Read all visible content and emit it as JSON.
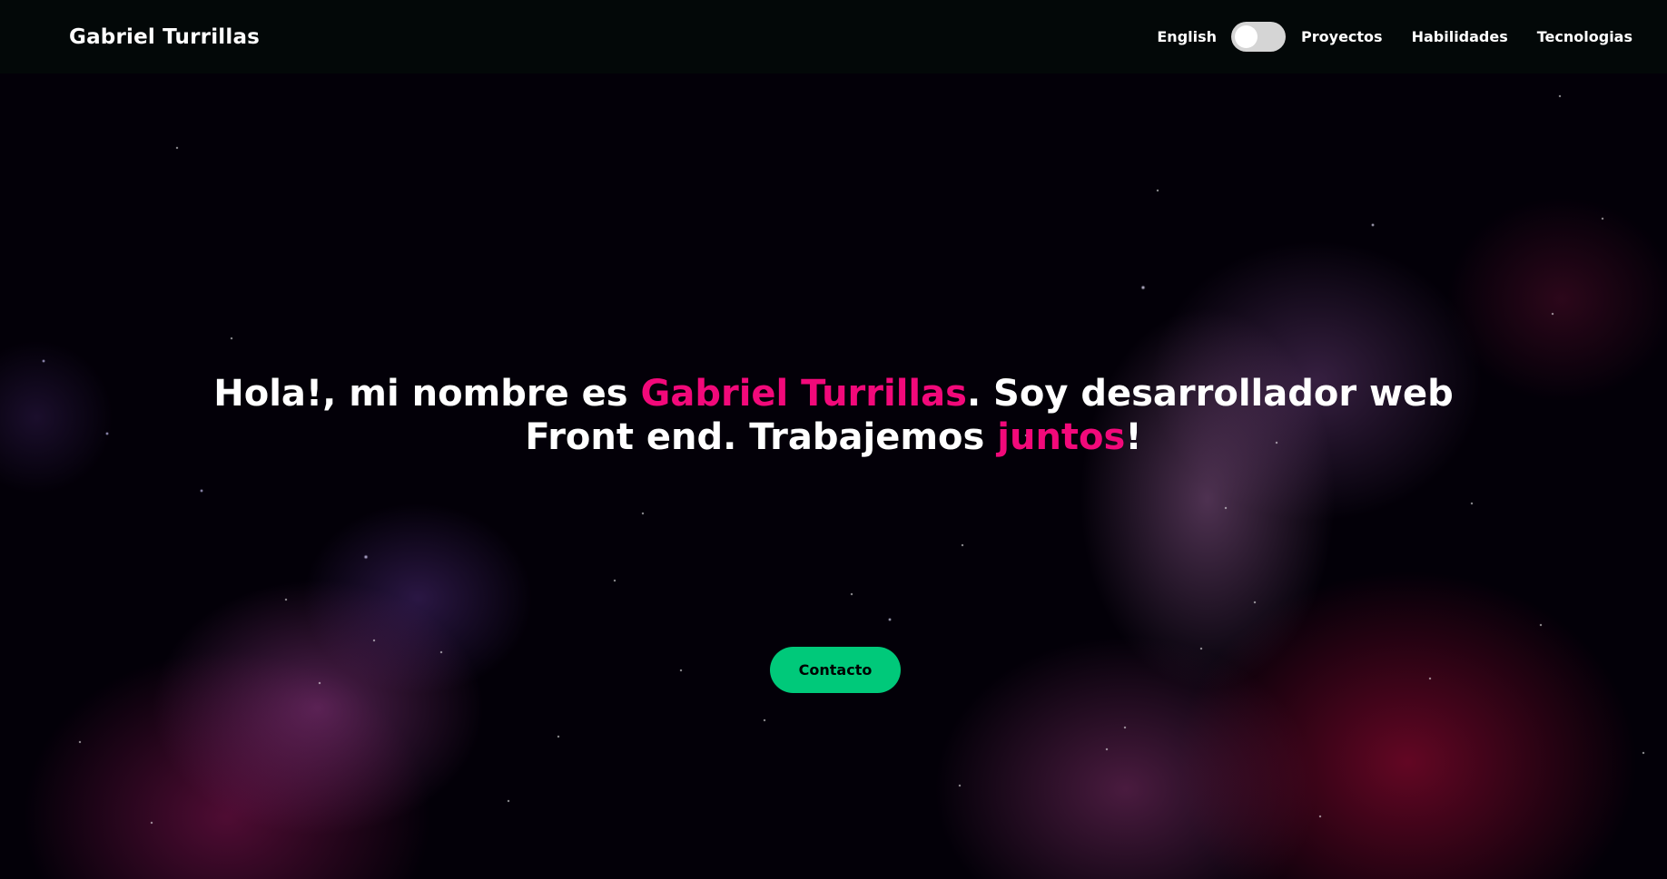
{
  "navbar": {
    "brand": "Gabriel Turrillas",
    "language_label": "English",
    "language_toggle_on": false,
    "links": [
      "Proyectos",
      "Habilidades",
      "Tecnologias"
    ]
  },
  "hero": {
    "line1_prefix": "Hola!, mi nombre es ",
    "name": "Gabriel Turrillas",
    "line1_suffix": ". Soy desarrollador web",
    "line2_prefix": "Front end. Trabajemos ",
    "line2_highlight": "juntos",
    "line2_suffix": "!"
  },
  "contact_button": {
    "label": "Contacto"
  },
  "colors": {
    "accent": "#f2097a",
    "button": "#00c97a",
    "navbar_bg": "#030808"
  }
}
